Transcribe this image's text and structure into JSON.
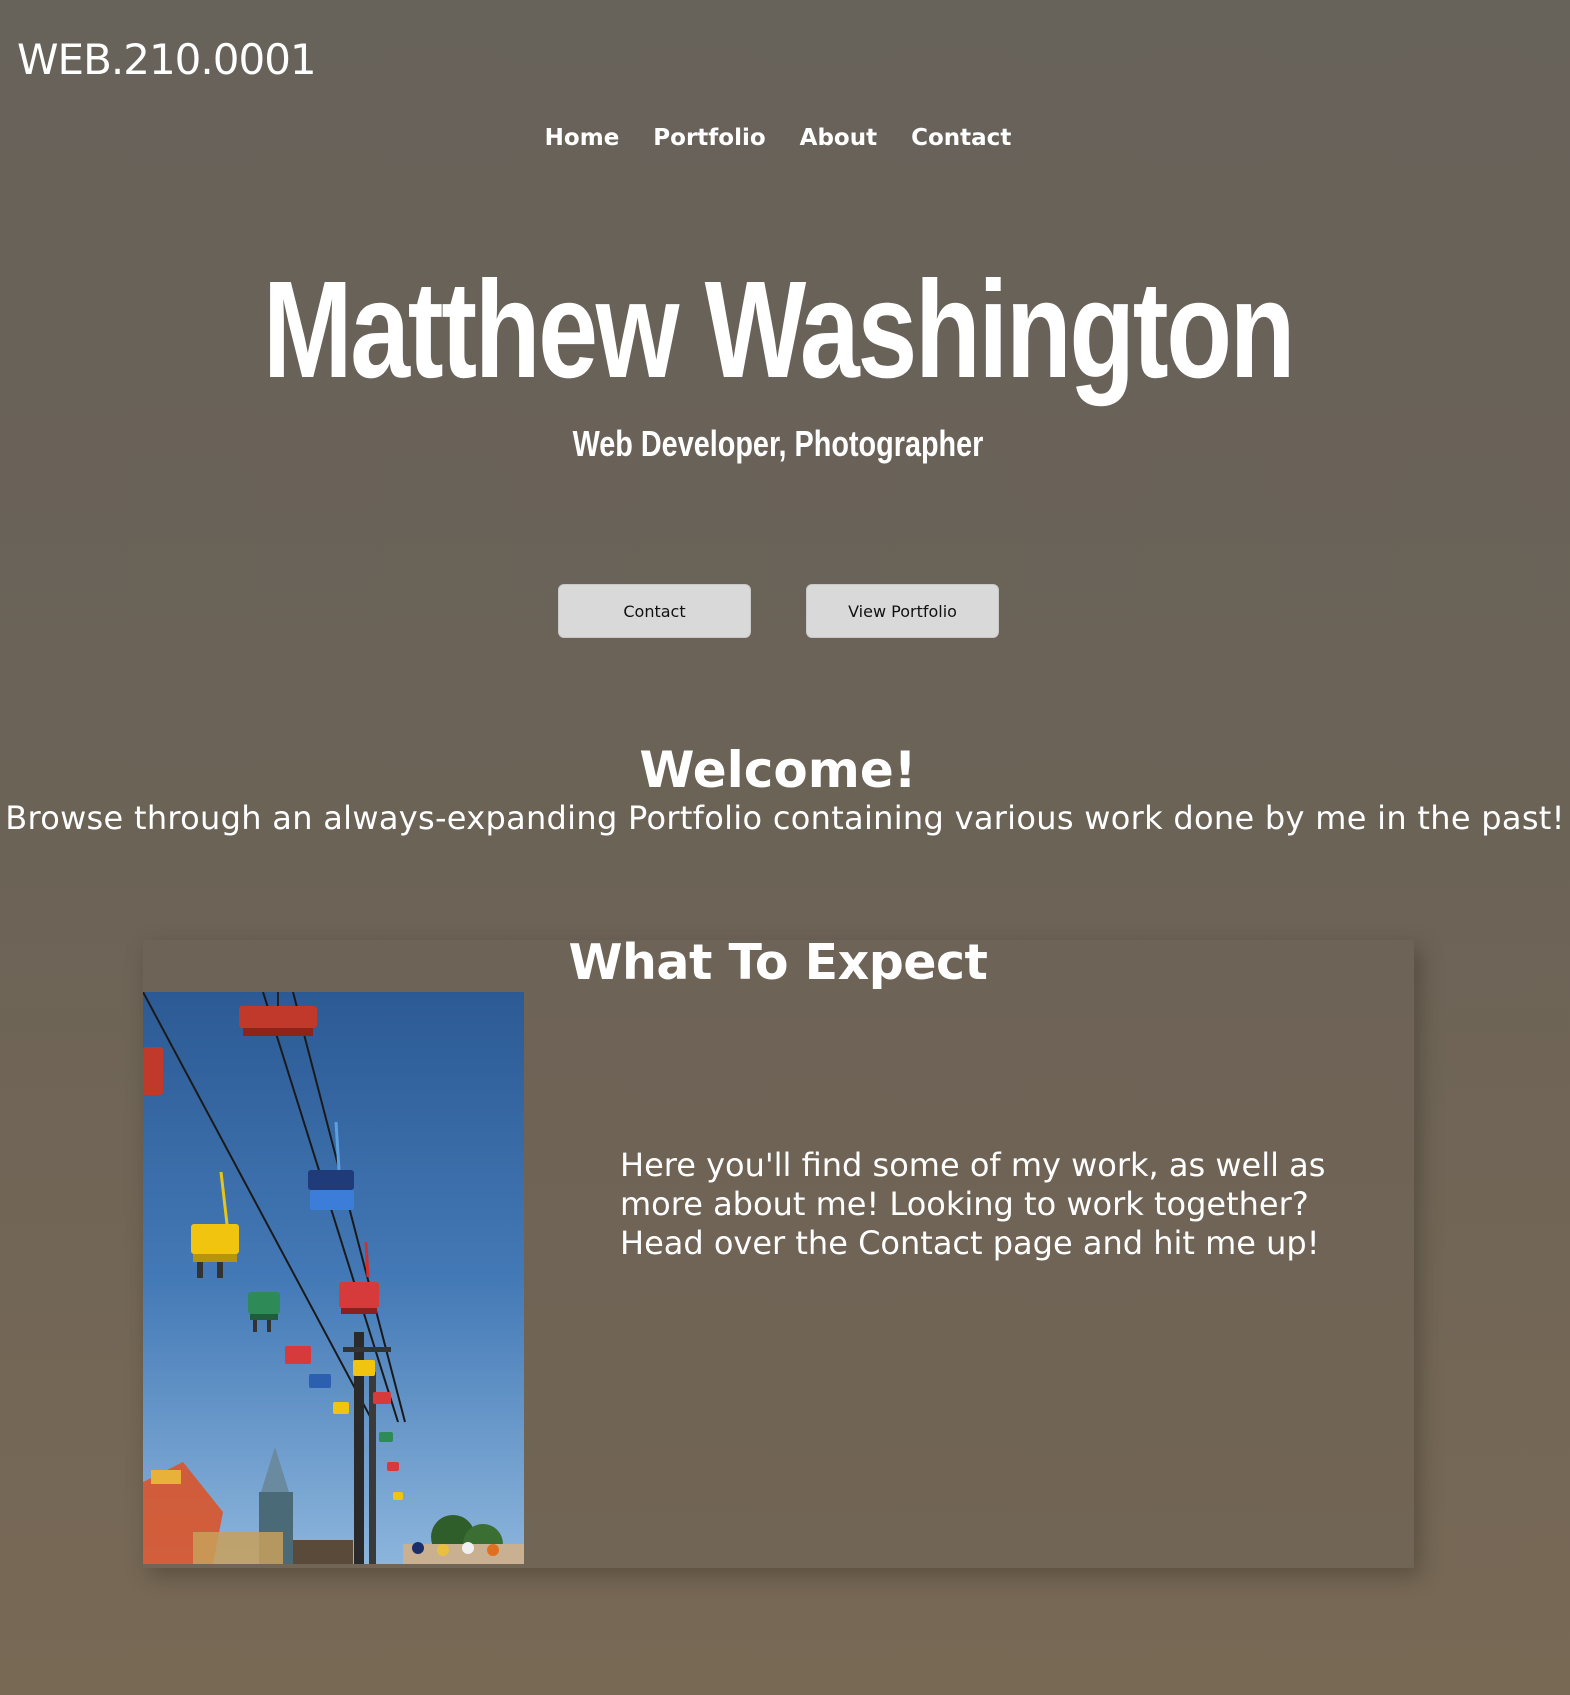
{
  "site": {
    "title": "WEB.210.0001"
  },
  "nav": {
    "items": [
      {
        "label": "Home"
      },
      {
        "label": "Portfolio"
      },
      {
        "label": "About"
      },
      {
        "label": "Contact"
      }
    ]
  },
  "hero": {
    "name": "Matthew Washington",
    "tagline": "Web Developer, Photographer",
    "contact_button": "Contact",
    "portfolio_button": "View Portfolio"
  },
  "welcome": {
    "heading": "Welcome!",
    "text": "Browse through an always-expanding Portfolio containing various work done by me in the past!"
  },
  "expect": {
    "heading": "What To Expect",
    "text": "Here you'll find some of my work, as well as more about me! Looking to work together? Head over the Contact page and hit me up!"
  },
  "colors": {
    "background_top": "#67625a",
    "background_bottom": "#786955",
    "button_bg": "#d9d9d9",
    "sky": "#3f6fa8"
  }
}
